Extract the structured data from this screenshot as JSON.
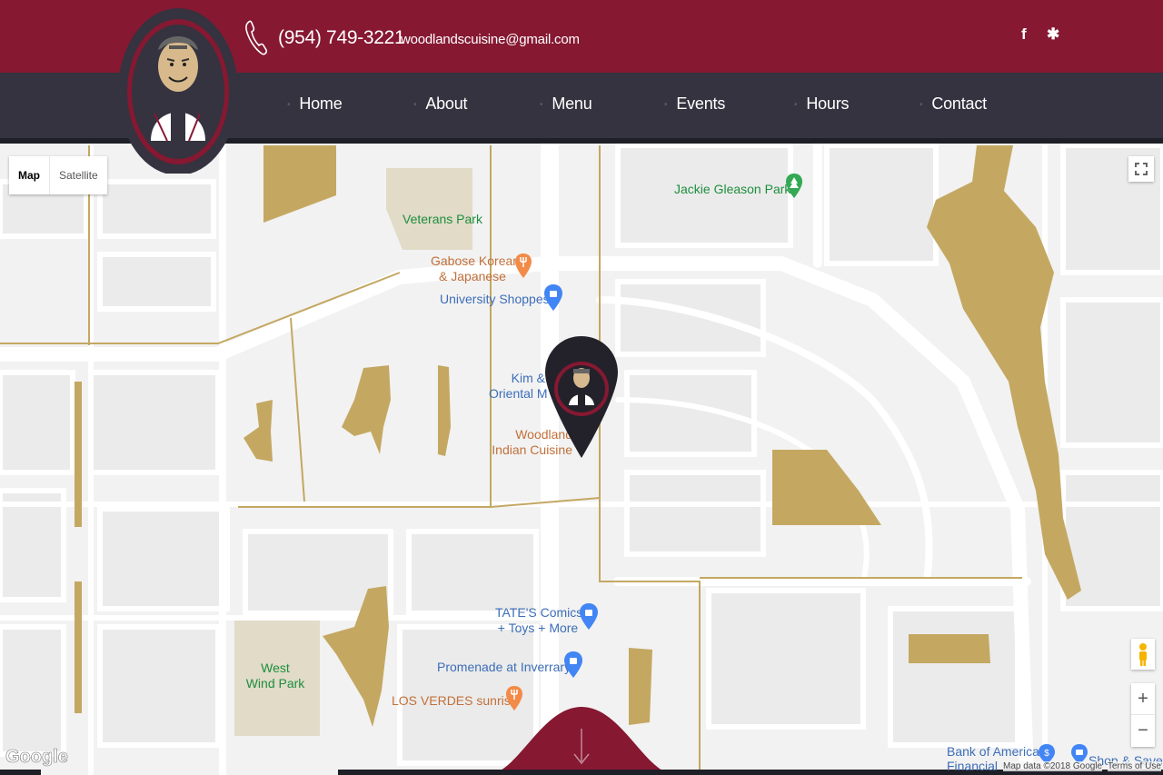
{
  "header": {
    "phone": "(954) 749-3221",
    "email": "woodlandscuisine@gmail.com",
    "social": [
      {
        "name": "facebook-icon",
        "glyph": "f"
      },
      {
        "name": "yelp-icon",
        "glyph": "✱"
      }
    ]
  },
  "nav": {
    "items": [
      {
        "label": "Home"
      },
      {
        "label": "About"
      },
      {
        "label": "Menu"
      },
      {
        "label": "Events"
      },
      {
        "label": "Hours"
      },
      {
        "label": "Contact"
      }
    ]
  },
  "map": {
    "type_controls": {
      "map": "Map",
      "satellite": "Satellite"
    },
    "places": {
      "jackie_gleason": "Jackie Gleason Park",
      "veterans": "Veterans Park",
      "gabose": "Gabose Korean\n& Japanese",
      "university": "University Shoppes",
      "kim": "Kim &\nOriental M",
      "woodlands": "Woodland\nIndian Cuisine",
      "tates": "TATE'S Comics\n+ Toys + More",
      "promenade": "Promenade at Inverrary",
      "losverdes": "LOS VERDES sunrise",
      "westwind": "West\nWind Park",
      "bank": "Bank of America\nFinancial",
      "shop": "Shop & Save"
    },
    "attribution": {
      "google": "Google",
      "data": "Map data ©2018 Google",
      "terms": "Terms of Use"
    },
    "zoom": {
      "in": "+",
      "out": "−"
    }
  },
  "colors": {
    "brand": "#861832",
    "nav_bg": "#34333f",
    "map_bg": "#f2f2f2",
    "road": "#ffffff",
    "water": "#c4a862",
    "park_block": "#e1dbc8"
  }
}
